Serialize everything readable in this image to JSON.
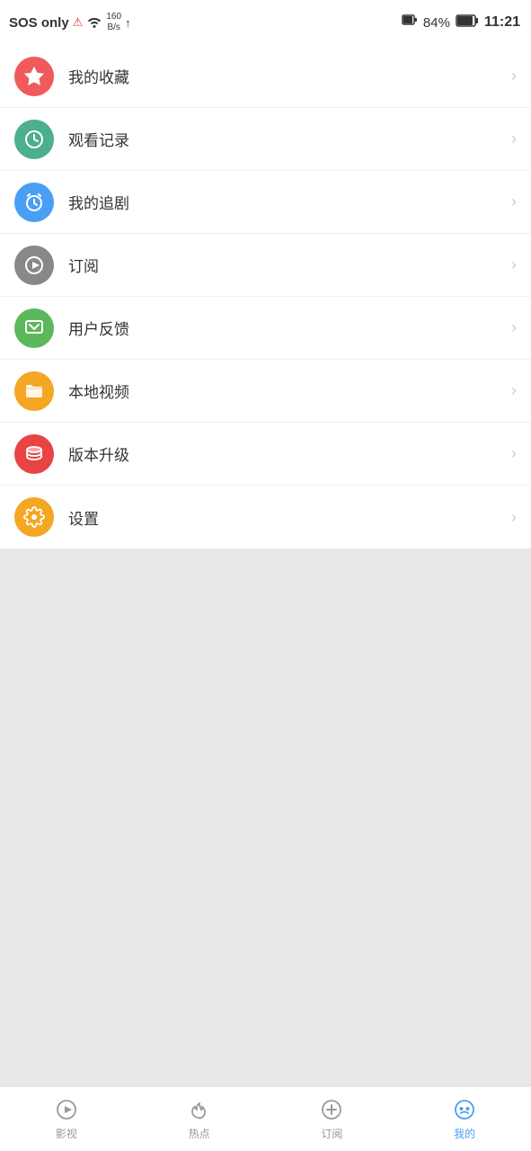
{
  "statusBar": {
    "sos": "SOS only",
    "signal": "!",
    "wifi": "≈",
    "speed": "160\nB/s",
    "upload": "↑",
    "battery": "84%",
    "time": "11:21"
  },
  "menuItems": [
    {
      "id": "favorites",
      "label": "我的收藏",
      "iconColor": "icon-red",
      "iconType": "star"
    },
    {
      "id": "history",
      "label": "观看记录",
      "iconColor": "icon-green-clock",
      "iconType": "clock"
    },
    {
      "id": "following",
      "label": "我的追剧",
      "iconColor": "icon-blue",
      "iconType": "alarm"
    },
    {
      "id": "subscribe",
      "label": "订阅",
      "iconColor": "icon-gray",
      "iconType": "play"
    },
    {
      "id": "feedback",
      "label": "用户反馈",
      "iconColor": "icon-green-msg",
      "iconType": "message"
    },
    {
      "id": "local",
      "label": "本地视频",
      "iconColor": "icon-orange-folder",
      "iconType": "folder"
    },
    {
      "id": "update",
      "label": "版本升级",
      "iconColor": "icon-red-stack",
      "iconType": "stack"
    },
    {
      "id": "settings",
      "label": "设置",
      "iconColor": "icon-orange-gear",
      "iconType": "gear"
    }
  ],
  "bottomNav": [
    {
      "id": "movies",
      "label": "影视",
      "iconType": "play-circle",
      "active": false
    },
    {
      "id": "hot",
      "label": "热点",
      "iconType": "fire",
      "active": false
    },
    {
      "id": "subscribe",
      "label": "订阅",
      "iconType": "plus-circle",
      "active": false
    },
    {
      "id": "mine",
      "label": "我的",
      "iconType": "smiley",
      "active": true
    }
  ]
}
